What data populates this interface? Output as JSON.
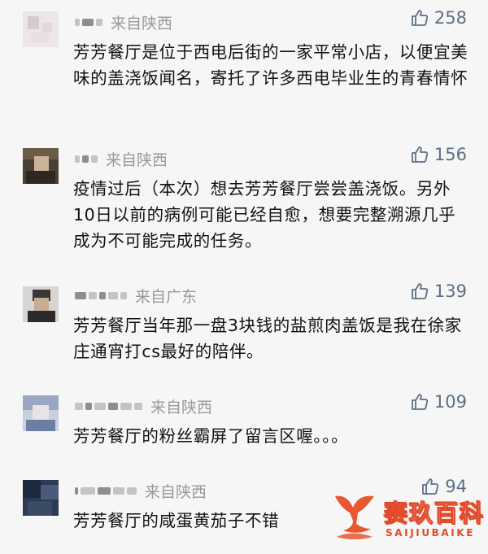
{
  "like_icon": "thumbs-up-icon",
  "accent_color": "#5d6f86",
  "comments": [
    {
      "location": "来自陕西",
      "likes": "258",
      "text": "芳芳餐厅是位于西电后街的一家平常小店，以便宜美味的盖浇饭闻名，寄托了许多西电毕业生的青春情怀"
    },
    {
      "location": "来自陕西",
      "likes": "156",
      "text": "疫情过后（本次）想去芳芳餐厅尝尝盖浇饭。另外10日以前的病例可能已经自愈，想要完整溯源几乎成为不可能完成的任务。"
    },
    {
      "location": "来自广东",
      "likes": "139",
      "text": "芳芳餐厅当年那一盘3块钱的盐煎肉盖饭是我在徐家庄通宵打cs最好的陪伴。"
    },
    {
      "location": "来自陕西",
      "likes": "109",
      "text": "芳芳餐厅的粉丝霸屏了留言区喔。。。"
    },
    {
      "location": "来自陕西",
      "likes": "94",
      "text": "芳芳餐厅的咸蛋黄茄子不错"
    }
  ],
  "watermark": {
    "name": "赛玖百科",
    "subtitle": "SAIJIUBAIKE",
    "logo_icon": "whale-tail-logo",
    "color": "#e24b2c"
  }
}
